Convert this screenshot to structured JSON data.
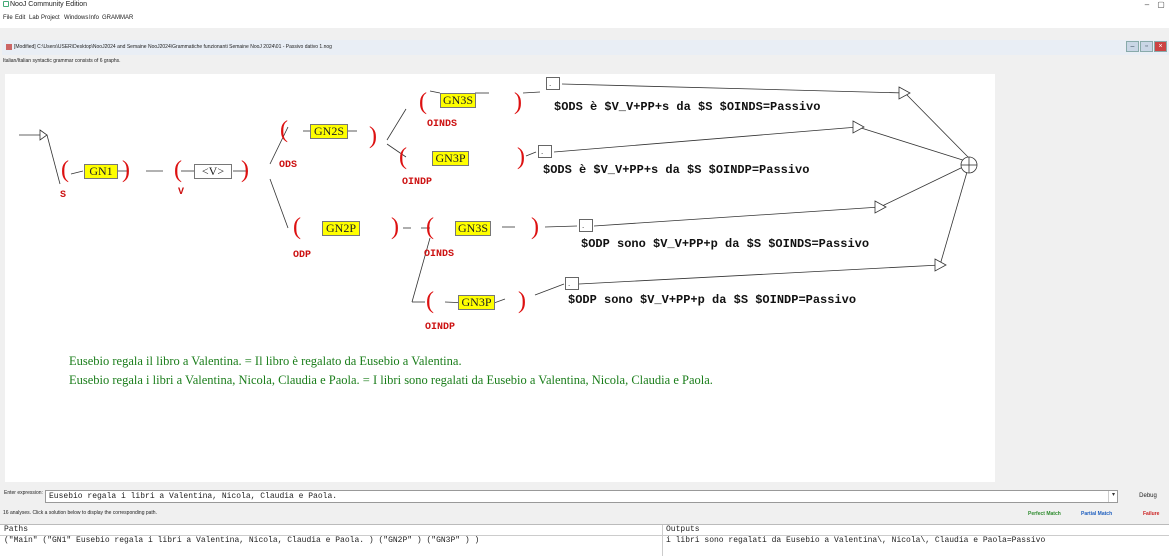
{
  "app": {
    "title": "NooJ Community Edition"
  },
  "menu": [
    "File",
    "Edit",
    "Lab",
    "Project",
    "Windows",
    "Info",
    "GRAMMAR"
  ],
  "document": {
    "title": "[Modified] C:\\Users\\USER\\Desktop\\NooJ2024 and Semaine NooJ2024\\Grammatiche funzionanti Semaine NooJ 2024\\01 - Passivo dativo 1.nog",
    "info": "Italian/Italian syntactic grammar consists of 6 graphs."
  },
  "graph": {
    "nodes": {
      "gn1": "GN1",
      "v": "<V>",
      "gn2s": "GN2S",
      "gn3s_top": "GN3S",
      "gn3p_top": "GN3P",
      "gn2p": "GN2P",
      "gn3s_bottom": "GN3S",
      "gn3p_bottom": "GN3P"
    },
    "paren_open": "(",
    "paren_close": ")",
    "box_node": ".",
    "vars": {
      "s": "S",
      "v": "V",
      "ods": "ODS",
      "odp": "ODP",
      "oinds_1": "OINDS",
      "oindp_1": "OINDP",
      "oinds_2": "OINDS",
      "oindp_2": "OINDP"
    },
    "outputs": {
      "o1": "$ODS è $V_V+PP+s da $S $OINDS=Passivo",
      "o2": "$ODS è $V_V+PP+s da $S $OINDP=Passivo",
      "o3": "$ODP sono $V_V+PP+p da $S $OINDS=Passivo",
      "o4": "$ODP sono $V_V+PP+p da $S $OINDP=Passivo"
    },
    "examples": [
      "Eusebio regala il libro a Valentina. = Il libro è regalato da Eusebio a Valentina.",
      "Eusebio regala i libri a Valentina, Nicola, Claudia e Paola. = I libri sono regalati da Eusebio a Valentina, Nicola, Claudia e Paola."
    ]
  },
  "expression": {
    "label": "Enter expression:",
    "value": "Eusebio regala i libri a Valentina, Nicola, Claudia e Paola.",
    "debug": "Debug"
  },
  "analyses": {
    "text": "16 analyses. Click a solution below to display the corresponding path.",
    "legend": {
      "perfect": "Perfect Match",
      "partial": "Partial Match",
      "failure": "Failure"
    },
    "colors": {
      "perfect": "#2e8b2e",
      "partial": "#1f5fbf",
      "failure": "#cc2222"
    }
  },
  "results": {
    "headers": {
      "paths": "Paths",
      "outputs": "Outputs"
    },
    "row": {
      "path": "(\"Main\"  (\"GN1\" Eusebio regala i libri a Valentina, Nicola, Claudia e Paola. ) (\"GN2P\"  ) (\"GN3P\"  ) )",
      "output": "i libri sono regalati da Eusebio a Valentina\\, Nicola\\, Claudia e Paola=Passivo"
    }
  }
}
